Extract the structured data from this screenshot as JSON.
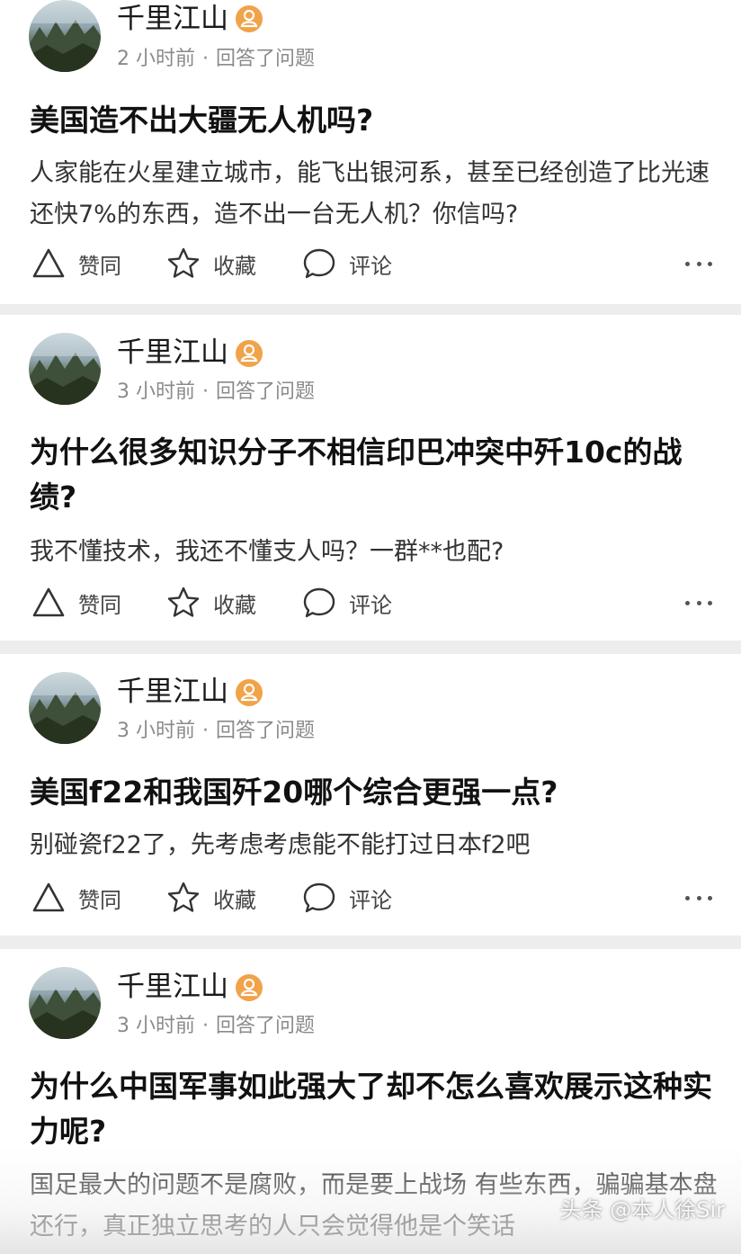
{
  "feed": {
    "cards": [
      {
        "author": "千里江山",
        "time": "2 小时前",
        "action": "回答了问题",
        "title": "美国造不出大疆无人机吗?",
        "excerpt": "人家能在火星建立城市，能飞出银河系，甚至已经创造了比光速还快7%的东西，造不出一台无人机？你信吗?"
      },
      {
        "author": "千里江山",
        "time": "3 小时前",
        "action": "回答了问题",
        "title": "为什么很多知识分子不相信印巴冲突中歼10c的战绩?",
        "excerpt": "我不懂技术，我还不懂支人吗？一群**也配?"
      },
      {
        "author": "千里江山",
        "time": "3 小时前",
        "action": "回答了问题",
        "title": "美国f22和我国歼20哪个综合更强一点?",
        "excerpt": "别碰瓷f22了，先考虑考虑能不能打过日本f2吧"
      },
      {
        "author": "千里江山",
        "time": "3 小时前",
        "action": "回答了问题",
        "title": "为什么中国军事如此强大了却不怎么喜欢展示这种实力呢?",
        "excerpt": "国足最大的问题不是腐败，而是要上战场 有些东西，骗骗基本盘还行，真正独立思考的人只会觉得他是个笑话"
      }
    ]
  },
  "action_bar": {
    "like_label": "赞同",
    "favorite_label": "收藏",
    "comment_label": "评论"
  },
  "separator": "·",
  "watermark": "头条 @本人徐Sir",
  "icons": {
    "like": "triangle-up-icon",
    "favorite": "star-icon",
    "comment": "speech-bubble-icon",
    "more": "more-dots-icon",
    "badge": "user-badge-icon"
  },
  "colors": {
    "badge": "#f0a349",
    "separator_bg": "#ededed"
  }
}
